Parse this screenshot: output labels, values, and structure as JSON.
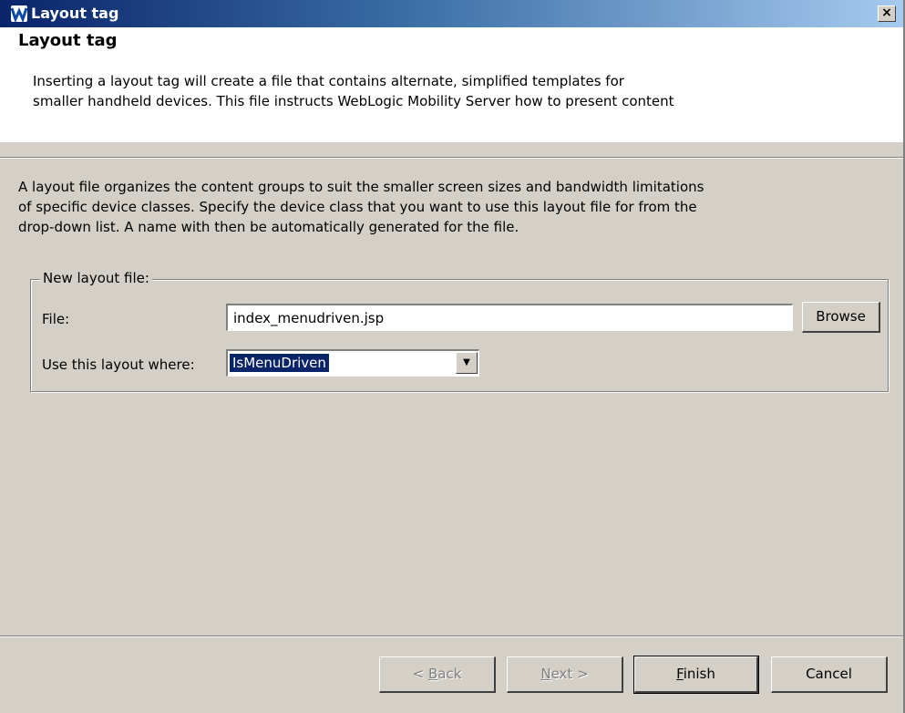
{
  "window": {
    "title": "Layout tag",
    "close_label": "×"
  },
  "header": {
    "title": "Layout tag",
    "description_line1": "Inserting a layout tag will create a file that contains alternate, simplified templates for",
    "description_line2": "smaller handheld devices. This file instructs WebLogic Mobility Server how to present content"
  },
  "body": {
    "description_line1": "A layout file organizes the content groups to suit the smaller screen sizes and bandwidth limitations",
    "description_line2": "of specific device classes. Specify the device class that you want to use this layout file for from the",
    "description_line3": "drop-down list. A name with then be automatically generated for the file."
  },
  "group": {
    "legend": "New layout file:",
    "file_label": "File:",
    "file_value": "index_menudriven.jsp",
    "browse_label": "Browse",
    "where_label": "Use this layout where:",
    "where_value": "IsMenuDriven"
  },
  "footer": {
    "back_mnemonic": "B",
    "back_rest": "ack",
    "back_prefix": "< ",
    "next_mnemonic": "N",
    "next_rest": "ext >",
    "finish_mnemonic": "F",
    "finish_rest": "inish",
    "cancel_label": "Cancel"
  },
  "colors": {
    "titlebar_start": "#0a246a",
    "titlebar_end": "#a6caf0",
    "dialog_background": "#d4d0c8",
    "selection": "#0a246a"
  }
}
